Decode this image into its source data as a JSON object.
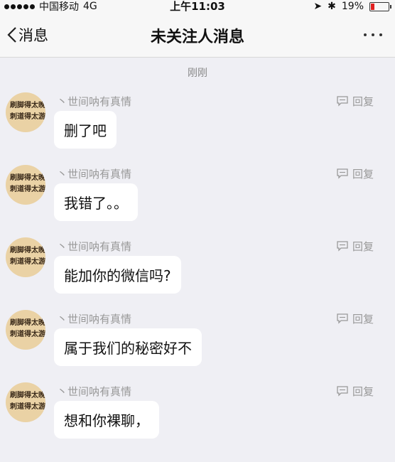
{
  "status": {
    "carrier": "中国移动",
    "network": "4G",
    "time": "上午11:03",
    "battery": "19%",
    "battery_level": 0.19
  },
  "nav": {
    "back_label": "消息",
    "title": "未关注人消息"
  },
  "timestamp": "刚刚",
  "avatar_text": "刷脚得太晚 刺道得太游",
  "messages": [
    {
      "sender": "丶世间呐有真情",
      "reply_label": "回复",
      "text": "删了吧"
    },
    {
      "sender": "丶世间呐有真情",
      "reply_label": "回复",
      "text": "我错了。。"
    },
    {
      "sender": "丶世间呐有真情",
      "reply_label": "回复",
      "text": "能加你的微信吗?"
    },
    {
      "sender": "丶世间呐有真情",
      "reply_label": "回复",
      "text": "属于我们的秘密好不"
    },
    {
      "sender": "丶世间呐有真情",
      "reply_label": "回复",
      "text": "想和你裸聊，"
    }
  ]
}
